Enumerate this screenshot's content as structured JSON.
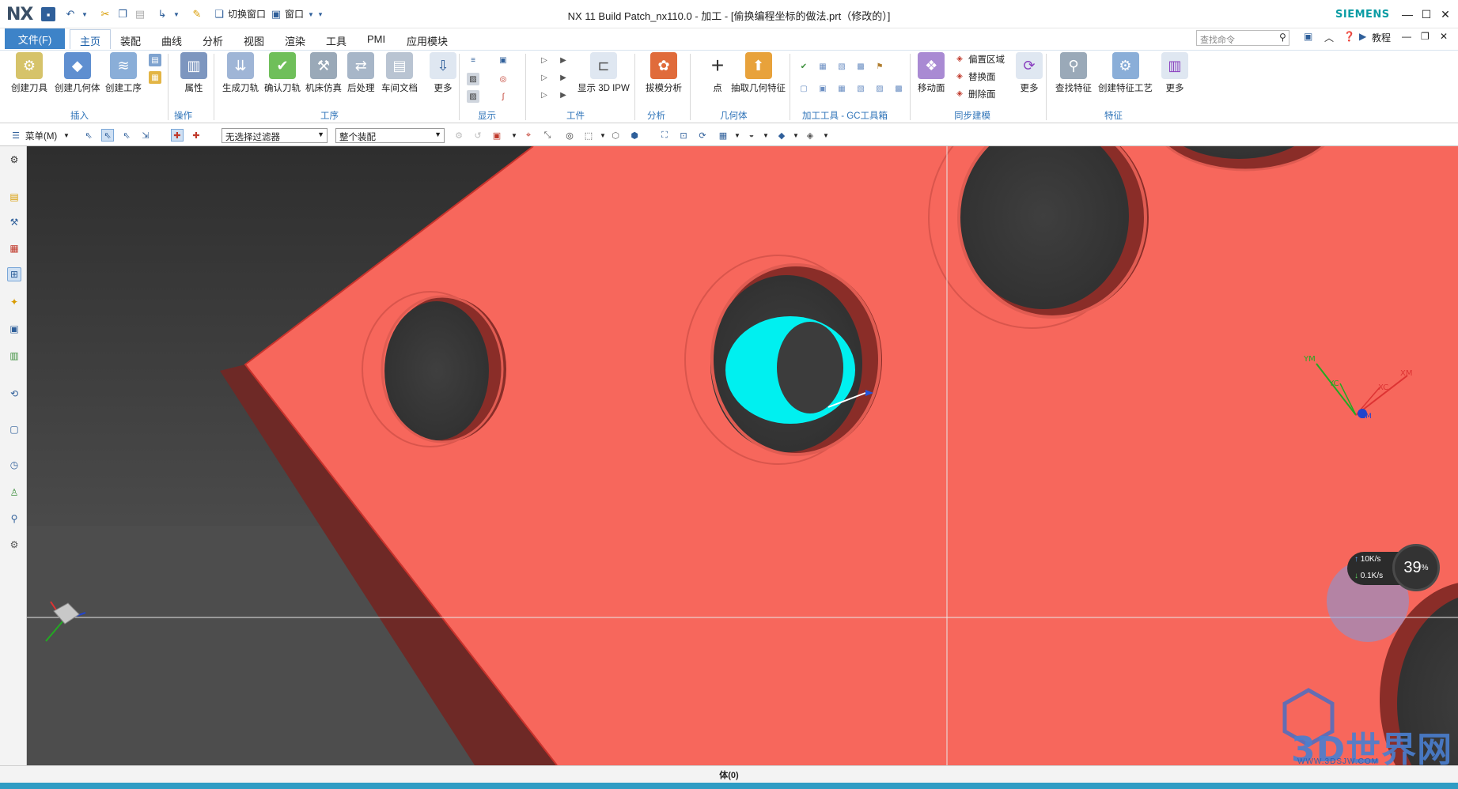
{
  "titlebar": {
    "logo": "NX",
    "switch_window": "切换窗口",
    "window_menu": "窗口",
    "title": "NX 11  Build Patch_nx110.0 - 加工 - [偷换编程坐标的做法.prt（修改的）]",
    "brand": "SIEMENS"
  },
  "menubar": {
    "file": "文件(F)",
    "tabs": [
      "主页",
      "装配",
      "曲线",
      "分析",
      "视图",
      "渲染",
      "工具",
      "PMI",
      "应用模块"
    ],
    "search_placeholder": "查找命令",
    "tutorial": "教程"
  },
  "ribbon": {
    "buttons": {
      "create_tool": "创建刀具",
      "create_geometry": "创建几何体",
      "create_operation": "创建工序",
      "properties": "属性",
      "generate_toolpath": "生成刀轨",
      "verify_toolpath": "确认刀轨",
      "machine_sim": "机床仿真",
      "postprocess": "后处理",
      "shop_doc": "车间文档",
      "more1": "更多",
      "show_3d_ipw": "显示 3D IPW",
      "draft_analysis": "拔模分析",
      "point": "点",
      "extract_geometry": "抽取几何特征",
      "move_face": "移动面",
      "offset_region": "偏置区域",
      "replace_face": "替换面",
      "delete_face": "删除面",
      "more2": "更多",
      "find_feature": "查找特征",
      "create_feature_process": "创建特征工艺",
      "more3": "更多"
    },
    "groups": {
      "insert": "插入",
      "operation": "操作",
      "process": "工序",
      "display": "显示",
      "workpiece": "工件",
      "analysis": "分析",
      "geometry": "几何体",
      "gc_toolkit": "加工工具 - GC工具箱",
      "sync_modeling": "同步建模",
      "feature": "特征"
    }
  },
  "toolbar2": {
    "menu": "菜单(M)",
    "filter": "无选择过滤器",
    "scope": "整个装配"
  },
  "viewport": {
    "wcs_labels": {
      "ym": "YM",
      "yc": "YC",
      "xm": "XM",
      "xc": "XC",
      "zm": "ZM"
    },
    "network_up": "10K/s",
    "network_down": "0.1K/s",
    "cpu_percent": "39",
    "cpu_unit": "%",
    "watermark": "3D世界网",
    "watermark_url": "WWW.3DSJW.COM"
  },
  "status": {
    "text": "体(0)"
  },
  "colors": {
    "part_face": "#f7675c",
    "part_edge": "#c9332c",
    "part_side": "#6e2926",
    "selected": "#00f0f0",
    "accent": "#3d83c8"
  }
}
